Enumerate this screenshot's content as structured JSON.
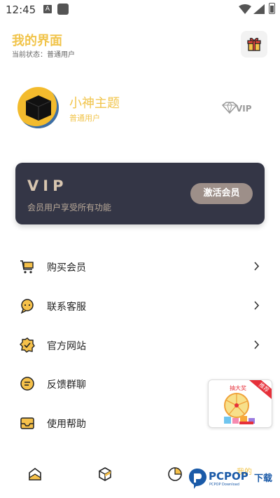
{
  "status_bar": {
    "time": "12:45",
    "notif_letter": "A"
  },
  "header": {
    "title": "我的界面",
    "state_label": "当前状态：普通用户"
  },
  "profile": {
    "name": "小神主题",
    "level": "普通用户",
    "vip_mark": "VIP"
  },
  "vip_card": {
    "title": "VIP",
    "description": "会员用户享受所有功能",
    "button": "激活会员"
  },
  "menu": [
    {
      "label": "购买会员",
      "icon": "cart-icon",
      "has_arrow": true
    },
    {
      "label": "联系客服",
      "icon": "chat-icon",
      "has_arrow": true
    },
    {
      "label": "官方网站",
      "icon": "badge-check-icon",
      "has_arrow": true
    },
    {
      "label": "反馈群聊",
      "icon": "feedback-icon",
      "has_arrow": false
    },
    {
      "label": "使用帮助",
      "icon": "help-inbox-icon",
      "has_arrow": false
    }
  ],
  "promo": {
    "ribbon": "推荐",
    "text": "抽大奖"
  },
  "bottom_nav": {
    "mine_label": "我的"
  },
  "watermark": {
    "brand": "PCPOP",
    "brand_cn": "下载",
    "sub": "PCPOP Download"
  },
  "colors": {
    "accent": "#f1c44b",
    "card_bg": "#343646",
    "card_text": "#d8c6b0",
    "button_bg": "#9d8f89"
  }
}
